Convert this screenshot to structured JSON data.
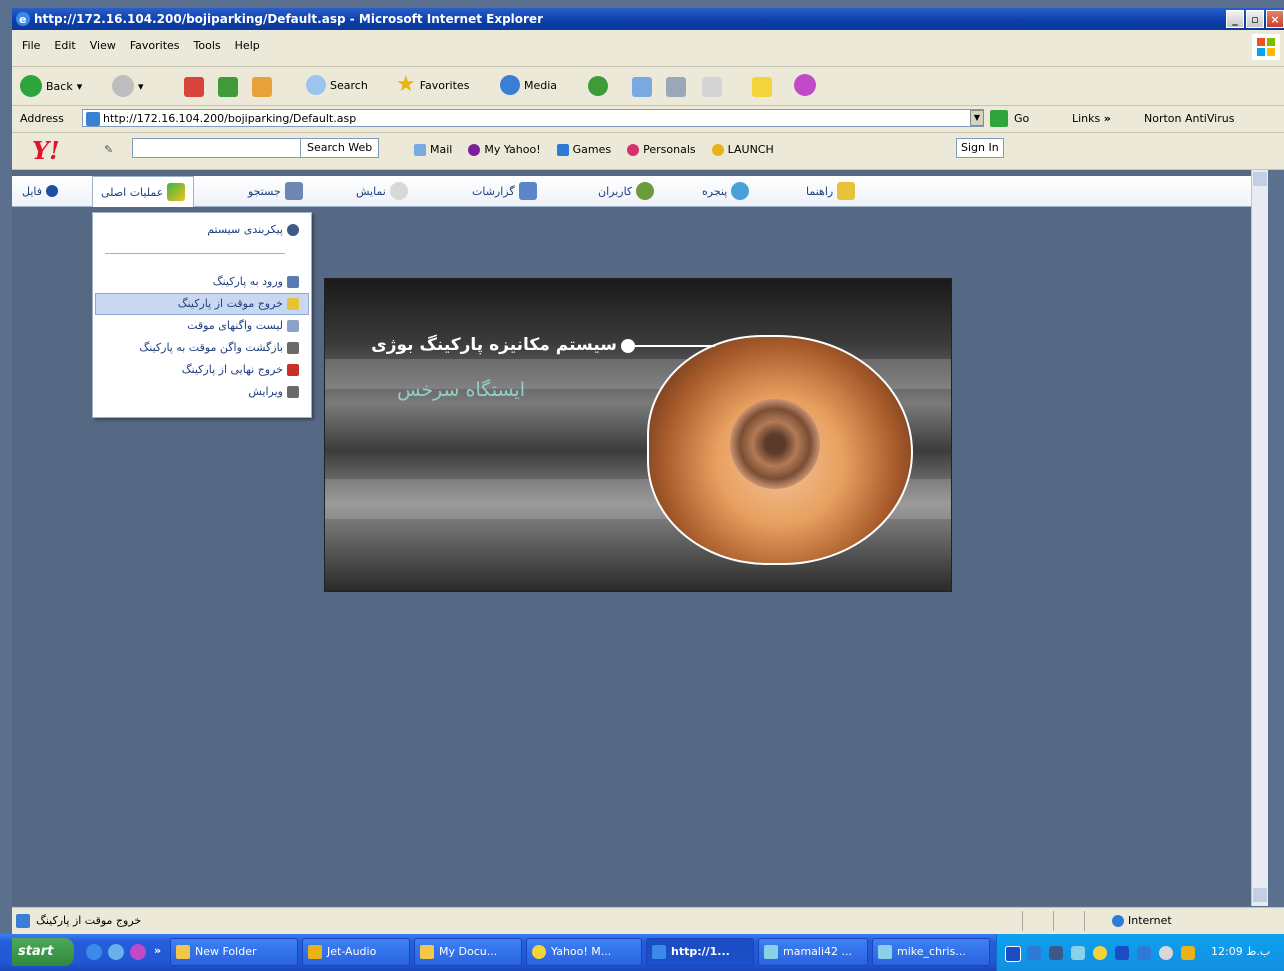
{
  "window": {
    "title": "http://172.16.104.200/bojiparking/Default.asp - Microsoft Internet Explorer",
    "minimize": "_",
    "maximize": "▫",
    "close": "×"
  },
  "menubar": {
    "items": [
      "File",
      "Edit",
      "View",
      "Favorites",
      "Tools",
      "Help"
    ]
  },
  "toolbar": {
    "back": "Back",
    "search": "Search",
    "favorites": "Favorites",
    "media": "Media"
  },
  "address": {
    "label": "Address",
    "url": "http://172.16.104.200/bojiparking/Default.asp",
    "go": "Go",
    "links": "Links",
    "links_chevron": "»",
    "norton": "Norton AntiVirus"
  },
  "yahoo": {
    "logo": "Y!",
    "search_btn": "Search Web",
    "mail": "Mail",
    "my_yahoo": "My Yahoo!",
    "games": "Games",
    "personals": "Personals",
    "launch": "LAUNCH",
    "sign_in": "Sign In"
  },
  "app_menu": {
    "items": [
      "فایل",
      "عملیات اصلی",
      "جستجو",
      "نمایش",
      "گزارشات",
      "کاربران",
      "پنجره",
      "راهنما"
    ]
  },
  "dropdown": {
    "items": [
      "پیکربندی سیستم",
      "ورود به پارکینگ",
      "خروج موقت از پارکینگ",
      "لیست واگنهای موقت",
      "بازگشت واگن موقت به پارکینگ",
      "خروج نهایی از پارکینگ",
      "ویرایش"
    ]
  },
  "banner": {
    "title": "سیستم مکانیزه پارکینگ بوژی",
    "subtitle": "ایستگاه سرخس"
  },
  "status": {
    "text": "خروج موقت از پارکینگ",
    "zone": "Internet"
  },
  "taskbar": {
    "start": "start",
    "quick_chevron": "»",
    "tasks": [
      "New Folder",
      "Jet-Audio",
      "My Docu...",
      "Yahoo! M...",
      "http://1...",
      "mamali42 ...",
      "mike_chris..."
    ],
    "clock": "12:09 ب.ظ"
  }
}
